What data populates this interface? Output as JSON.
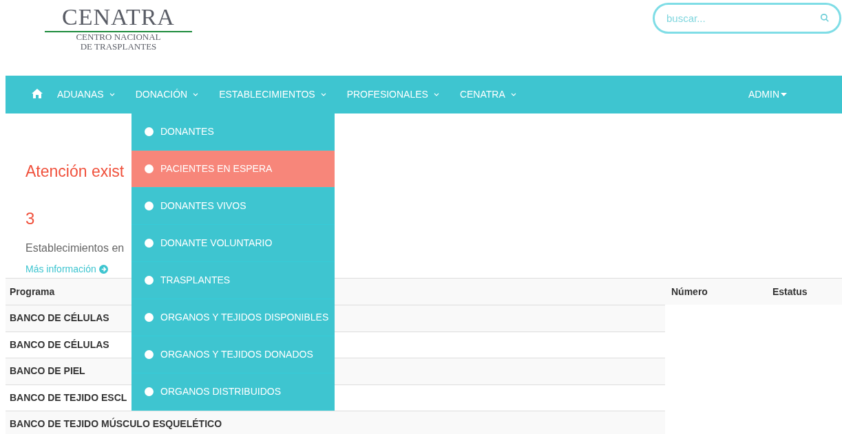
{
  "logo": {
    "title": "CENATRA",
    "subtitle_lines": [
      "CENTRO NACIONAL",
      "DE TRASPLANTES"
    ]
  },
  "search": {
    "placeholder": "buscar..."
  },
  "nav": {
    "items": [
      "ADUANAS",
      "DONACIÓN",
      "ESTABLECIMIENTOS",
      "PROFESIONALES",
      "CENATRA"
    ],
    "user": "ADMIN"
  },
  "dropdown": [
    {
      "label": "DONANTES",
      "selected": false
    },
    {
      "label": "PACIENTES EN ESPERA",
      "selected": true
    },
    {
      "label": "DONANTES VIVOS",
      "selected": false
    },
    {
      "label": "DONANTE VOLUNTARIO",
      "selected": false
    },
    {
      "label": "TRASPLANTES",
      "selected": false
    },
    {
      "label": "ORGANOS Y TEJIDOS DISPONIBLES",
      "selected": false
    },
    {
      "label": "ORGANOS Y TEJIDOS DONADOS",
      "selected": false
    },
    {
      "label": "ORGANOS DISTRIBUIDOS",
      "selected": false
    }
  ],
  "alert": "Atención exist",
  "stats": [
    {
      "value": "3",
      "label": "Establecimientos en",
      "link": "Más información"
    }
  ],
  "table": {
    "columns": [
      "Programa",
      "Número",
      "Estatus"
    ],
    "rows": [
      [
        "BANCO DE CÉLULAS"
      ],
      [
        "BANCO DE CÉLULAS"
      ],
      [
        "BANCO DE PIEL"
      ],
      [
        "BANCO DE TEJIDO ESCL"
      ],
      [
        "BANCO DE TEJIDO MÚSCULO ESQUELÉTICO"
      ]
    ]
  }
}
